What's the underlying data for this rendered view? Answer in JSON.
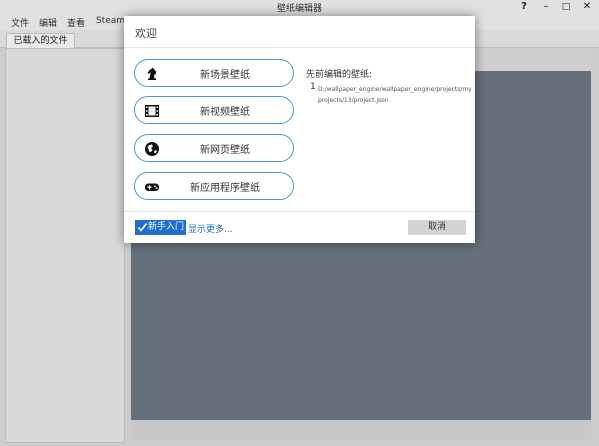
{
  "window": {
    "title": "壁纸编辑器",
    "controls": {
      "help": "?",
      "minimize": "–",
      "maximize": "□",
      "close": "✕"
    }
  },
  "menu": {
    "items": [
      "文件",
      "编辑",
      "查看",
      "Steam"
    ]
  },
  "tabs": [
    {
      "label": "已载入的文件"
    }
  ],
  "dialog": {
    "title": "欢迎",
    "create_buttons": [
      {
        "label": "新场景壁纸",
        "icon": "chess-knight-icon"
      },
      {
        "label": "新视频壁纸",
        "icon": "film-strip-icon"
      },
      {
        "label": "新网页壁纸",
        "icon": "globe-icon"
      },
      {
        "label": "新应用程序壁纸",
        "icon": "gamepad-icon"
      }
    ],
    "recent": {
      "heading": "先前编辑的壁纸:",
      "items": [
        {
          "index": "1",
          "path": "D:/wallpaper_engine/wallpaper_engine/projects/myprojects/13/project.json"
        }
      ]
    },
    "footer": {
      "tutorial_label": "新手入门",
      "show_more_label": "显示更多...",
      "cancel_label": "取消"
    }
  },
  "colors": {
    "accent": "#1f6fd0",
    "button_border": "#4b9ad6",
    "viewport": "#6c7883"
  }
}
